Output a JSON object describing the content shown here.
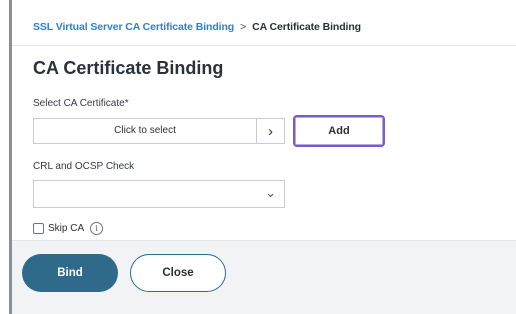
{
  "breadcrumb": {
    "parent": "SSL Virtual Server CA Certificate Binding",
    "separator": ">",
    "current": "CA Certificate Binding"
  },
  "page_title": "CA Certificate Binding",
  "select_ca": {
    "label": "Select CA Certificate*",
    "placeholder": "Click to select",
    "arrow": "›"
  },
  "add_button": {
    "label": "Add"
  },
  "crl_ocsp": {
    "label": "CRL and OCSP Check",
    "value": "",
    "chevron": "⌄"
  },
  "skip_ca": {
    "label": "Skip CA",
    "checked": false,
    "info_glyph": "i"
  },
  "footer": {
    "bind_label": "Bind",
    "close_label": "Close"
  },
  "colors": {
    "accent": "#2f6a8a",
    "link": "#2f7fcf",
    "focus": "#7a5cc8"
  }
}
